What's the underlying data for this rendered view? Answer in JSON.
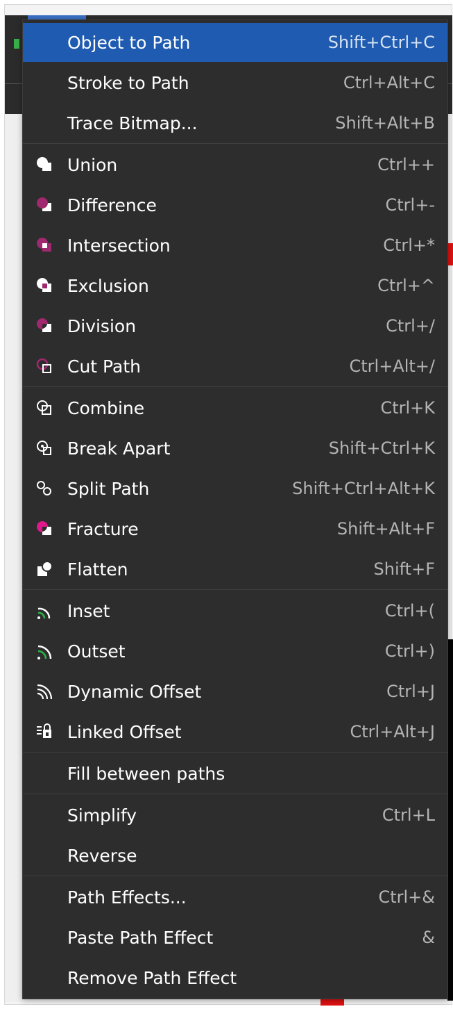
{
  "menu": {
    "items": [
      {
        "label": "Object to Path",
        "shortcut": "Shift+Ctrl+C",
        "icon": "",
        "active": true
      },
      {
        "label": "Stroke to Path",
        "shortcut": "Ctrl+Alt+C",
        "icon": ""
      },
      {
        "label": "Trace Bitmap...",
        "shortcut": "Shift+Alt+B",
        "icon": ""
      },
      {
        "label": "Union",
        "shortcut": "Ctrl++",
        "icon": "union-icon"
      },
      {
        "label": "Difference",
        "shortcut": "Ctrl+-",
        "icon": "difference-icon"
      },
      {
        "label": "Intersection",
        "shortcut": "Ctrl+*",
        "icon": "intersection-icon"
      },
      {
        "label": "Exclusion",
        "shortcut": "Ctrl+^",
        "icon": "exclusion-icon"
      },
      {
        "label": "Division",
        "shortcut": "Ctrl+/",
        "icon": "division-icon"
      },
      {
        "label": "Cut Path",
        "shortcut": "Ctrl+Alt+/",
        "icon": "cut-path-icon"
      },
      {
        "label": "Combine",
        "shortcut": "Ctrl+K",
        "icon": "combine-icon"
      },
      {
        "label": "Break Apart",
        "shortcut": "Shift+Ctrl+K",
        "icon": "break-apart-icon"
      },
      {
        "label": "Split Path",
        "shortcut": "Shift+Ctrl+Alt+K",
        "icon": "split-path-icon"
      },
      {
        "label": "Fracture",
        "shortcut": "Shift+Alt+F",
        "icon": "fracture-icon"
      },
      {
        "label": "Flatten",
        "shortcut": "Shift+F",
        "icon": "flatten-icon"
      },
      {
        "label": "Inset",
        "shortcut": "Ctrl+(",
        "icon": "inset-icon"
      },
      {
        "label": "Outset",
        "shortcut": "Ctrl+)",
        "icon": "outset-icon"
      },
      {
        "label": "Dynamic Offset",
        "shortcut": "Ctrl+J",
        "icon": "dynamic-offset-icon"
      },
      {
        "label": "Linked Offset",
        "shortcut": "Ctrl+Alt+J",
        "icon": "linked-offset-icon"
      },
      {
        "label": "Fill between paths",
        "shortcut": "",
        "icon": ""
      },
      {
        "label": "Simplify",
        "shortcut": "Ctrl+L",
        "icon": ""
      },
      {
        "label": "Reverse",
        "shortcut": "",
        "icon": ""
      },
      {
        "label": "Path Effects...",
        "shortcut": "Ctrl+&",
        "icon": ""
      },
      {
        "label": "Paste Path Effect",
        "shortcut": "&",
        "icon": ""
      },
      {
        "label": "Remove Path Effect",
        "shortcut": "",
        "icon": ""
      }
    ]
  },
  "colors": {
    "menu_bg": "#2d2d2d",
    "highlight": "#1f5bb0",
    "text": "#ffffff",
    "shortcut_text": "#b4b4b4",
    "boolean_accent": "#a0286e",
    "fracture_accent": "#e0188a",
    "offset_accent": "#2db34a"
  }
}
